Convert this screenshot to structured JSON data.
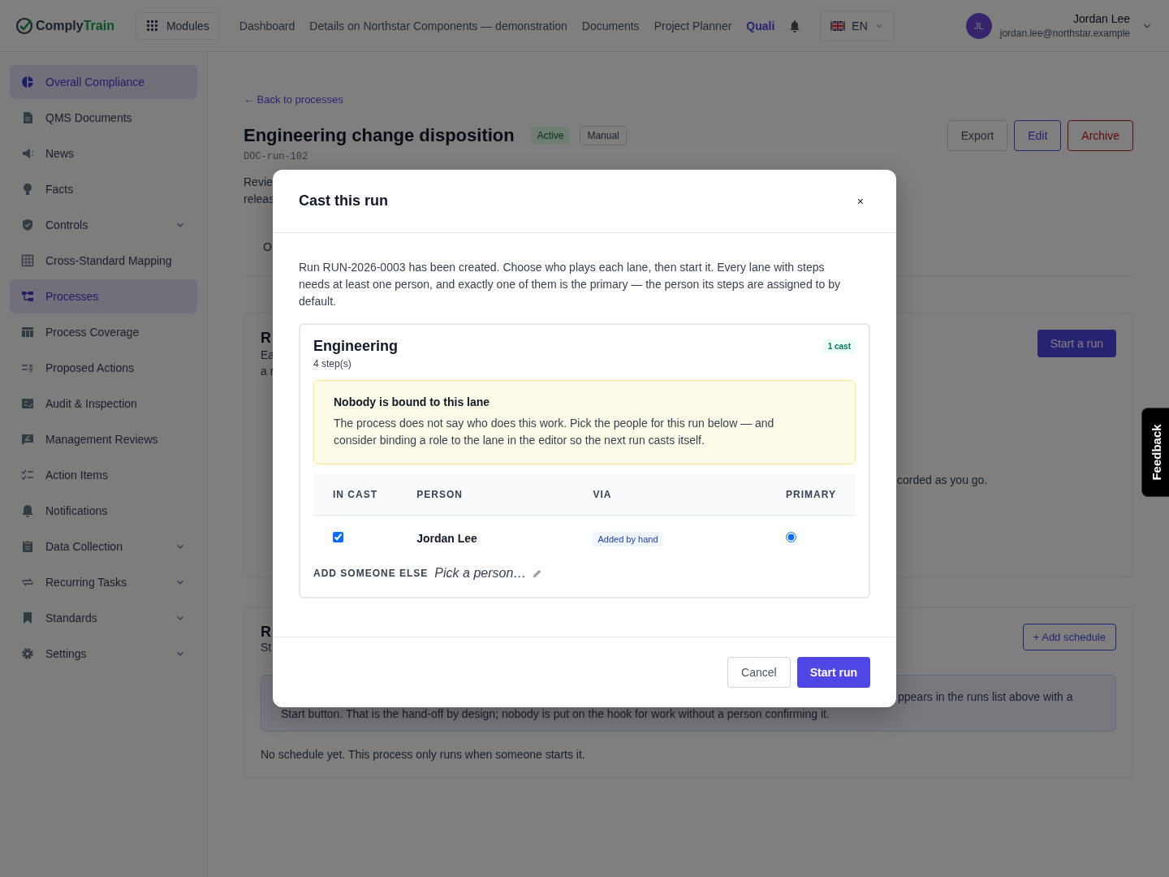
{
  "brand": {
    "first": "Comply",
    "second": "Train"
  },
  "topbar": {
    "modules": "Modules",
    "nav": [
      {
        "label": "Dashboard",
        "selected": false
      },
      {
        "label": "Details on Northstar Components — demonstration",
        "selected": false
      },
      {
        "label": "Documents",
        "selected": false
      },
      {
        "label": "Project Planner",
        "selected": false
      },
      {
        "label": "Quali",
        "selected": true
      }
    ],
    "language": "EN",
    "user": {
      "initials": "JL",
      "name": "Jordan Lee",
      "email": "jordan.lee@northstar.example"
    }
  },
  "sidebar": {
    "items": [
      {
        "label": "Overall Compliance",
        "selected": true,
        "has_submenu": false
      },
      {
        "label": "QMS Documents",
        "selected": false,
        "has_submenu": false
      },
      {
        "label": "News",
        "selected": false,
        "has_submenu": false
      },
      {
        "label": "Facts",
        "selected": false,
        "has_submenu": false
      },
      {
        "label": "Controls",
        "selected": false,
        "has_submenu": true
      },
      {
        "label": "Cross-Standard Mapping",
        "selected": false,
        "has_submenu": false
      },
      {
        "label": "Processes",
        "selected": true,
        "has_submenu": false
      },
      {
        "label": "Process Coverage",
        "selected": false,
        "has_submenu": false
      },
      {
        "label": "Proposed Actions",
        "selected": false,
        "has_submenu": false
      },
      {
        "label": "Audit & Inspection",
        "selected": false,
        "has_submenu": false
      },
      {
        "label": "Management Reviews",
        "selected": false,
        "has_submenu": false
      },
      {
        "label": "Action Items",
        "selected": false,
        "has_submenu": false
      },
      {
        "label": "Notifications",
        "selected": false,
        "has_submenu": false
      },
      {
        "label": "Data Collection",
        "selected": false,
        "has_submenu": true
      },
      {
        "label": "Recurring Tasks",
        "selected": false,
        "has_submenu": true
      },
      {
        "label": "Standards",
        "selected": false,
        "has_submenu": true
      },
      {
        "label": "Settings",
        "selected": false,
        "has_submenu": true
      }
    ]
  },
  "page": {
    "back_link": "← Back to processes",
    "title": "Engineering change disposition",
    "badges": [
      "Active",
      "Manual"
    ],
    "doc_id": "DOC-run-102",
    "description": [
      "Revie",
      "releas"
    ],
    "tab": "O",
    "actions": [
      "Export",
      "Edit",
      "Archive"
    ],
    "runs_card": {
      "title": "R",
      "text": [
        "Ea",
        "a r"
      ],
      "start_button": "Start a run",
      "note": "corded as you go."
    },
    "schedule_card": {
      "title": "R",
      "subtitle": "St",
      "add_button": "+ Add schedule",
      "info": [
        "ppears in the runs list above with a",
        "Start button. That is the hand-off by design; nobody is put on the hook for work without a person confirming it."
      ],
      "empty": "No schedule yet. This process only runs when someone starts it."
    }
  },
  "feedback": "Feedback",
  "modal": {
    "title": "Cast this run",
    "close": "×",
    "intro": "Run RUN-2026-0003 has been created. Choose who plays each lane, then start it. Every lane with steps needs at least one person, and exactly one of them is the primary — the person its steps are assigned to by default.",
    "lane": {
      "name": "Engineering",
      "steps": "4 step(s)",
      "badge": "1 cast",
      "warning": {
        "title": "Nobody is bound to this lane",
        "text": "The process does not say who does this work. Pick the people for this run below — and consider binding a role to the lane in the editor so the next run casts itself."
      },
      "columns": [
        "IN CAST",
        "PERSON",
        "VIA",
        "PRIMARY"
      ],
      "rows": [
        {
          "in_cast": true,
          "person": "Jordan Lee",
          "via": "Added by hand",
          "primary": true
        }
      ],
      "add_label": "ADD SOMEONE ELSE",
      "add_placeholder": "Pick a person…"
    },
    "buttons": {
      "cancel": "Cancel",
      "start": "Start run"
    }
  }
}
